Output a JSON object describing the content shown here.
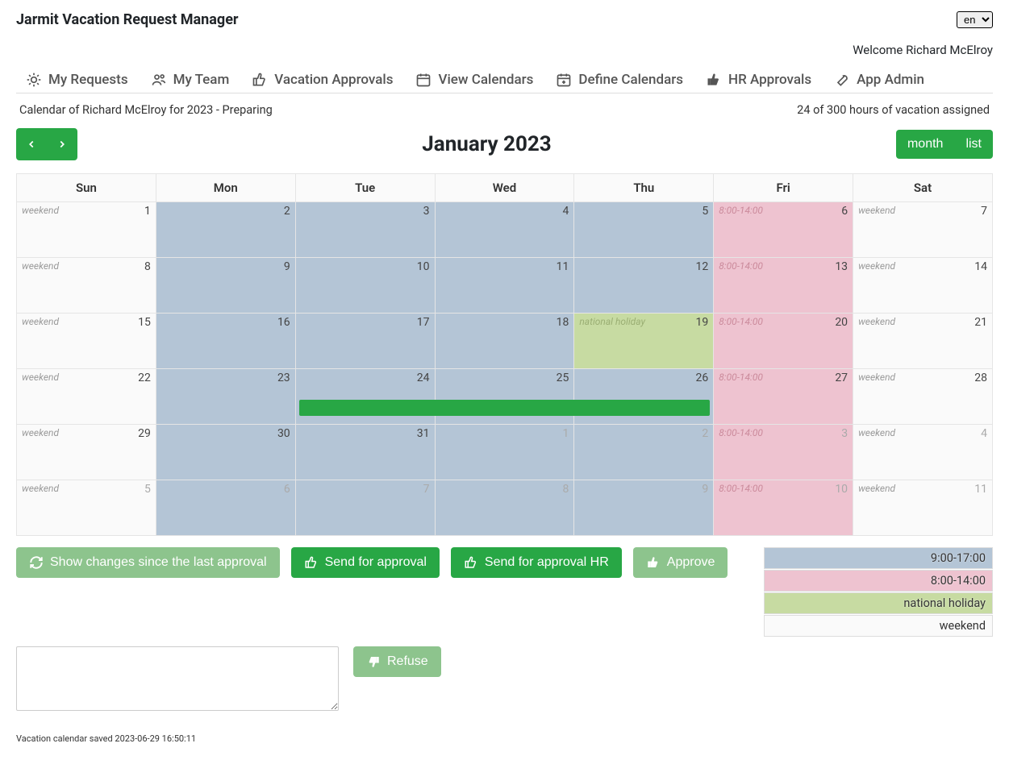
{
  "header": {
    "app_title": "Jarmit Vacation Request Manager",
    "lang_options": [
      "en"
    ],
    "lang_selected": "en",
    "welcome": "Welcome Richard McElroy"
  },
  "tabs": {
    "my_requests": "My Requests",
    "my_team": "My Team",
    "vacation_approvals": "Vacation Approvals",
    "view_calendars": "View Calendars",
    "define_calendars": "Define Calendars",
    "hr_approvals": "HR Approvals",
    "app_admin": "App Admin"
  },
  "status": {
    "left": "Calendar of Richard McElroy for 2023 - Preparing",
    "right": "24 of 300 hours of vacation assigned"
  },
  "calendar": {
    "title": "January 2023",
    "view_month": "month",
    "view_list": "list",
    "day_headers": [
      "Sun",
      "Mon",
      "Tue",
      "Wed",
      "Thu",
      "Fri",
      "Sat"
    ],
    "weeks": [
      [
        {
          "n": "1",
          "bg": "weekend",
          "label": "weekend",
          "muted": false
        },
        {
          "n": "2",
          "bg": "blue",
          "label": "",
          "muted": false
        },
        {
          "n": "3",
          "bg": "blue",
          "label": "",
          "muted": false
        },
        {
          "n": "4",
          "bg": "blue",
          "label": "",
          "muted": false
        },
        {
          "n": "5",
          "bg": "blue",
          "label": "",
          "muted": false
        },
        {
          "n": "6",
          "bg": "pink",
          "label": "8:00-14:00",
          "muted": false
        },
        {
          "n": "7",
          "bg": "weekend",
          "label": "weekend",
          "muted": false
        }
      ],
      [
        {
          "n": "8",
          "bg": "weekend",
          "label": "weekend",
          "muted": false
        },
        {
          "n": "9",
          "bg": "blue",
          "label": "",
          "muted": false
        },
        {
          "n": "10",
          "bg": "blue",
          "label": "",
          "muted": false
        },
        {
          "n": "11",
          "bg": "blue",
          "label": "",
          "muted": false
        },
        {
          "n": "12",
          "bg": "blue",
          "label": "",
          "muted": false
        },
        {
          "n": "13",
          "bg": "pink",
          "label": "8:00-14:00",
          "muted": false
        },
        {
          "n": "14",
          "bg": "weekend",
          "label": "weekend",
          "muted": false
        }
      ],
      [
        {
          "n": "15",
          "bg": "weekend",
          "label": "weekend",
          "muted": false
        },
        {
          "n": "16",
          "bg": "blue",
          "label": "",
          "muted": false
        },
        {
          "n": "17",
          "bg": "blue",
          "label": "",
          "muted": false
        },
        {
          "n": "18",
          "bg": "blue",
          "label": "",
          "muted": false
        },
        {
          "n": "19",
          "bg": "green",
          "label": "national holiday",
          "muted": false
        },
        {
          "n": "20",
          "bg": "pink",
          "label": "8:00-14:00",
          "muted": false
        },
        {
          "n": "21",
          "bg": "weekend",
          "label": "weekend",
          "muted": false
        }
      ],
      [
        {
          "n": "22",
          "bg": "weekend",
          "label": "weekend",
          "muted": false
        },
        {
          "n": "23",
          "bg": "blue",
          "label": "",
          "muted": false
        },
        {
          "n": "24",
          "bg": "blue",
          "label": "",
          "muted": false,
          "event": "start"
        },
        {
          "n": "25",
          "bg": "blue",
          "label": "",
          "muted": false,
          "event": "mid"
        },
        {
          "n": "26",
          "bg": "blue",
          "label": "",
          "muted": false,
          "event": "end"
        },
        {
          "n": "27",
          "bg": "pink",
          "label": "8:00-14:00",
          "muted": false
        },
        {
          "n": "28",
          "bg": "weekend",
          "label": "weekend",
          "muted": false
        }
      ],
      [
        {
          "n": "29",
          "bg": "weekend",
          "label": "weekend",
          "muted": false
        },
        {
          "n": "30",
          "bg": "blue",
          "label": "",
          "muted": false
        },
        {
          "n": "31",
          "bg": "blue",
          "label": "",
          "muted": false
        },
        {
          "n": "1",
          "bg": "blue",
          "label": "",
          "muted": true
        },
        {
          "n": "2",
          "bg": "blue",
          "label": "",
          "muted": true
        },
        {
          "n": "3",
          "bg": "pink",
          "label": "8:00-14:00",
          "muted": true
        },
        {
          "n": "4",
          "bg": "weekend",
          "label": "weekend",
          "muted": true
        }
      ],
      [
        {
          "n": "5",
          "bg": "weekend",
          "label": "weekend",
          "muted": true
        },
        {
          "n": "6",
          "bg": "blue",
          "label": "",
          "muted": true
        },
        {
          "n": "7",
          "bg": "blue",
          "label": "",
          "muted": true
        },
        {
          "n": "8",
          "bg": "blue",
          "label": "",
          "muted": true
        },
        {
          "n": "9",
          "bg": "blue",
          "label": "",
          "muted": true
        },
        {
          "n": "10",
          "bg": "pink",
          "label": "8:00-14:00",
          "muted": true
        },
        {
          "n": "11",
          "bg": "weekend",
          "label": "weekend",
          "muted": true
        }
      ]
    ]
  },
  "actions": {
    "show_changes": "Show changes since the last approval",
    "send_approval": "Send for approval",
    "send_approval_hr": "Send for approval HR",
    "approve": "Approve",
    "refuse": "Refuse"
  },
  "legend": {
    "blue": "9:00-17:00",
    "pink": "8:00-14:00",
    "green": "national holiday",
    "weekend": "weekend"
  },
  "saved_msg": "Vacation calendar saved 2023-06-29 16:50:11",
  "refuse_text": ""
}
